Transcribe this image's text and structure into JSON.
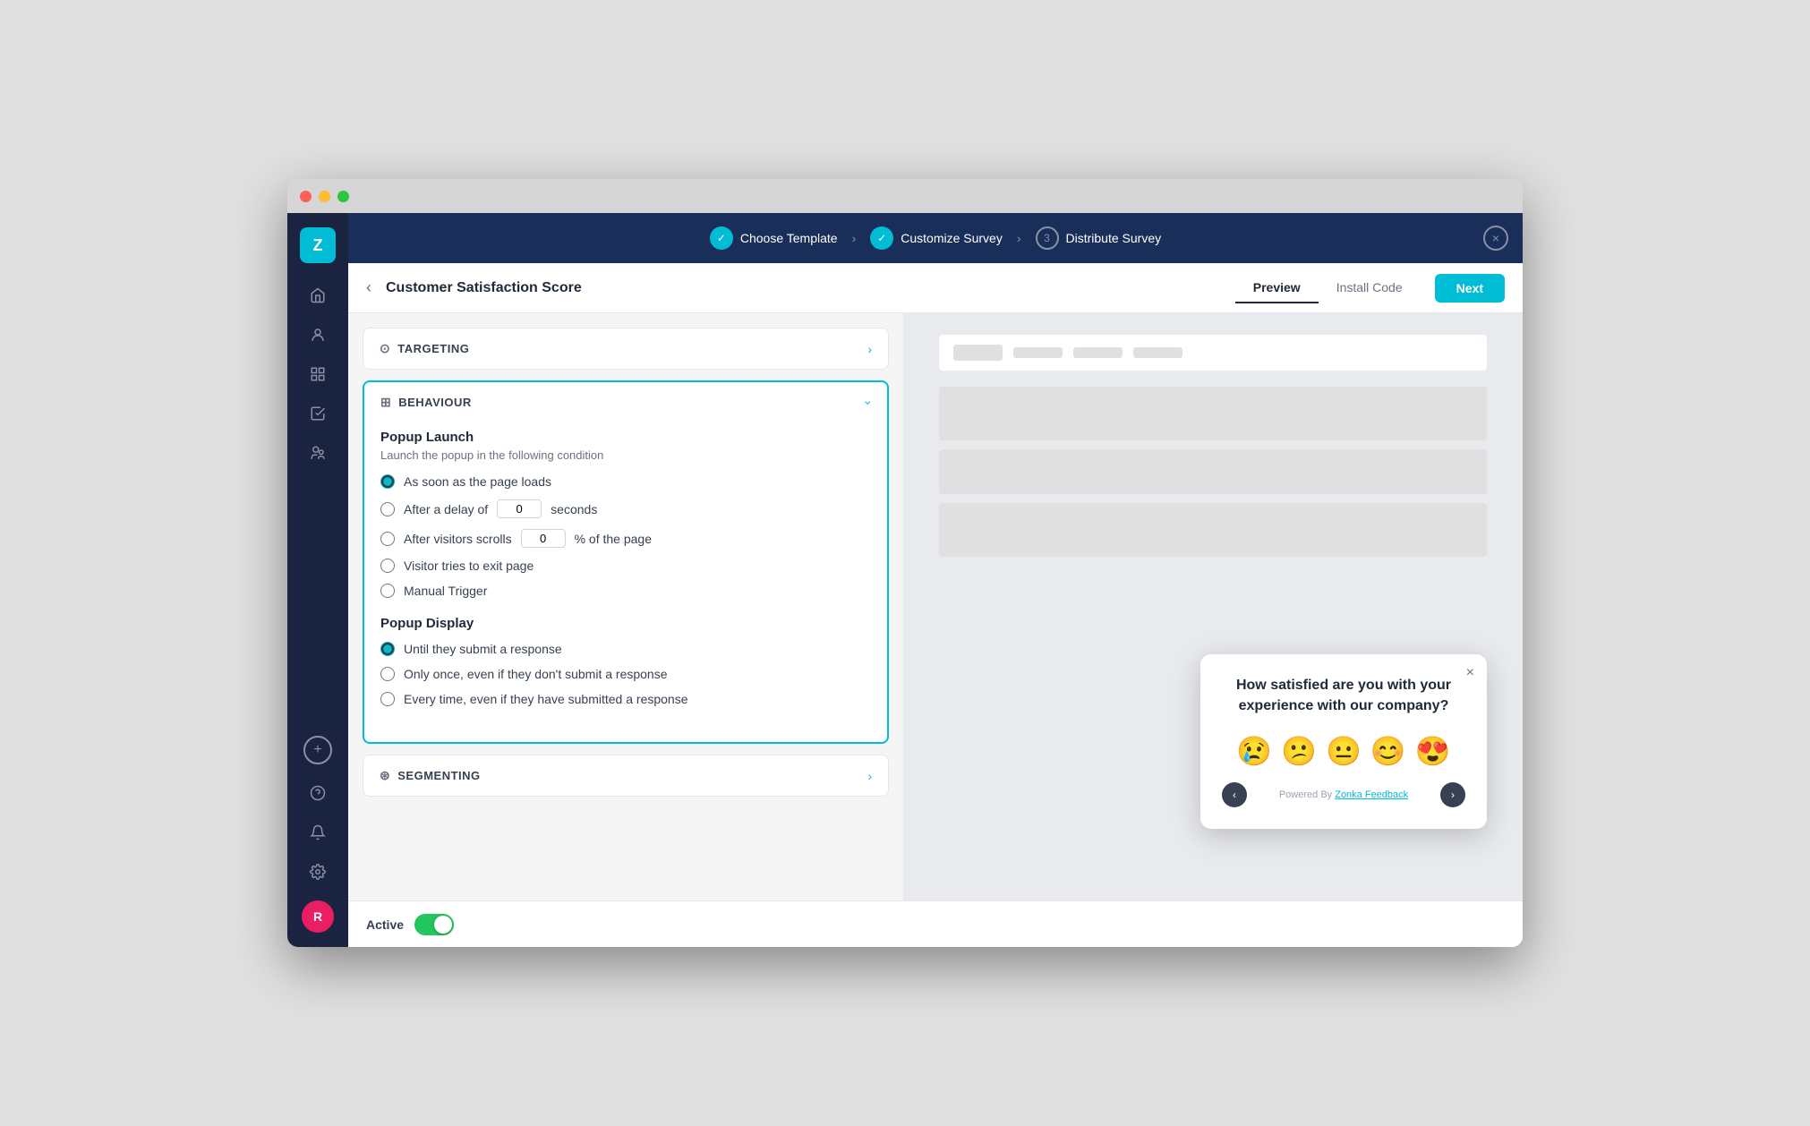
{
  "window": {
    "title": "Zonka Feedback"
  },
  "topnav": {
    "steps": [
      {
        "label": "Choose Template",
        "type": "check",
        "id": "step-1"
      },
      {
        "label": "Customize Survey",
        "type": "check",
        "id": "step-2"
      },
      {
        "label": "Distribute Survey",
        "type": "number",
        "number": "3",
        "id": "step-3"
      }
    ],
    "close_label": "×"
  },
  "header": {
    "back_label": "‹",
    "title": "Customer Satisfaction Score",
    "tabs": [
      {
        "label": "Preview",
        "active": true
      },
      {
        "label": "Install Code",
        "active": false
      }
    ],
    "next_label": "Next"
  },
  "sidebar": {
    "logo": "Z",
    "icons": [
      "⌂",
      "☻",
      "♟",
      "✓",
      "♣"
    ],
    "bottom_icons": [
      "?",
      "🔔",
      "⚙"
    ],
    "avatar": "R"
  },
  "targeting": {
    "header_label": "TARGETING",
    "header_icon": "⊙"
  },
  "behaviour": {
    "header_label": "BEHAVIOUR",
    "header_icon": "⊞",
    "popup_launch": {
      "title": "Popup Launch",
      "description": "Launch the popup in the following condition",
      "options": [
        {
          "id": "opt-page-loads",
          "label": "As soon as the page loads",
          "checked": true,
          "has_input": false
        },
        {
          "id": "opt-delay",
          "label_before": "After a delay of",
          "label_after": "seconds",
          "checked": false,
          "has_input": true,
          "input_value": "0"
        },
        {
          "id": "opt-scroll",
          "label_before": "After visitors scrolls",
          "label_after": "% of the page",
          "checked": false,
          "has_input": true,
          "input_value": "0"
        },
        {
          "id": "opt-exit",
          "label": "Visitor tries to exit page",
          "checked": false,
          "has_input": false
        },
        {
          "id": "opt-manual",
          "label": "Manual Trigger",
          "checked": false,
          "has_input": false
        }
      ]
    },
    "popup_display": {
      "title": "Popup Display",
      "options": [
        {
          "id": "disp-until",
          "label": "Until they submit a response",
          "checked": true
        },
        {
          "id": "disp-once",
          "label": "Only once, even if they don't submit a response",
          "checked": false
        },
        {
          "id": "disp-every",
          "label": "Every time, even if they have submitted a response",
          "checked": false
        }
      ]
    }
  },
  "segmenting": {
    "header_label": "SEGMENTING",
    "header_icon": "⊛"
  },
  "active_bar": {
    "label": "Active",
    "toggle_on": true
  },
  "preview": {
    "survey_popup": {
      "question": "How satisfied are you with your experience with our company?",
      "emojis": [
        "😢",
        "😕",
        "😐",
        "😊",
        "😍"
      ],
      "footer_text": "Powered By ",
      "footer_link": "Zonka Feedback",
      "close_label": "×",
      "nav_prev": "‹",
      "nav_next": "›"
    }
  }
}
